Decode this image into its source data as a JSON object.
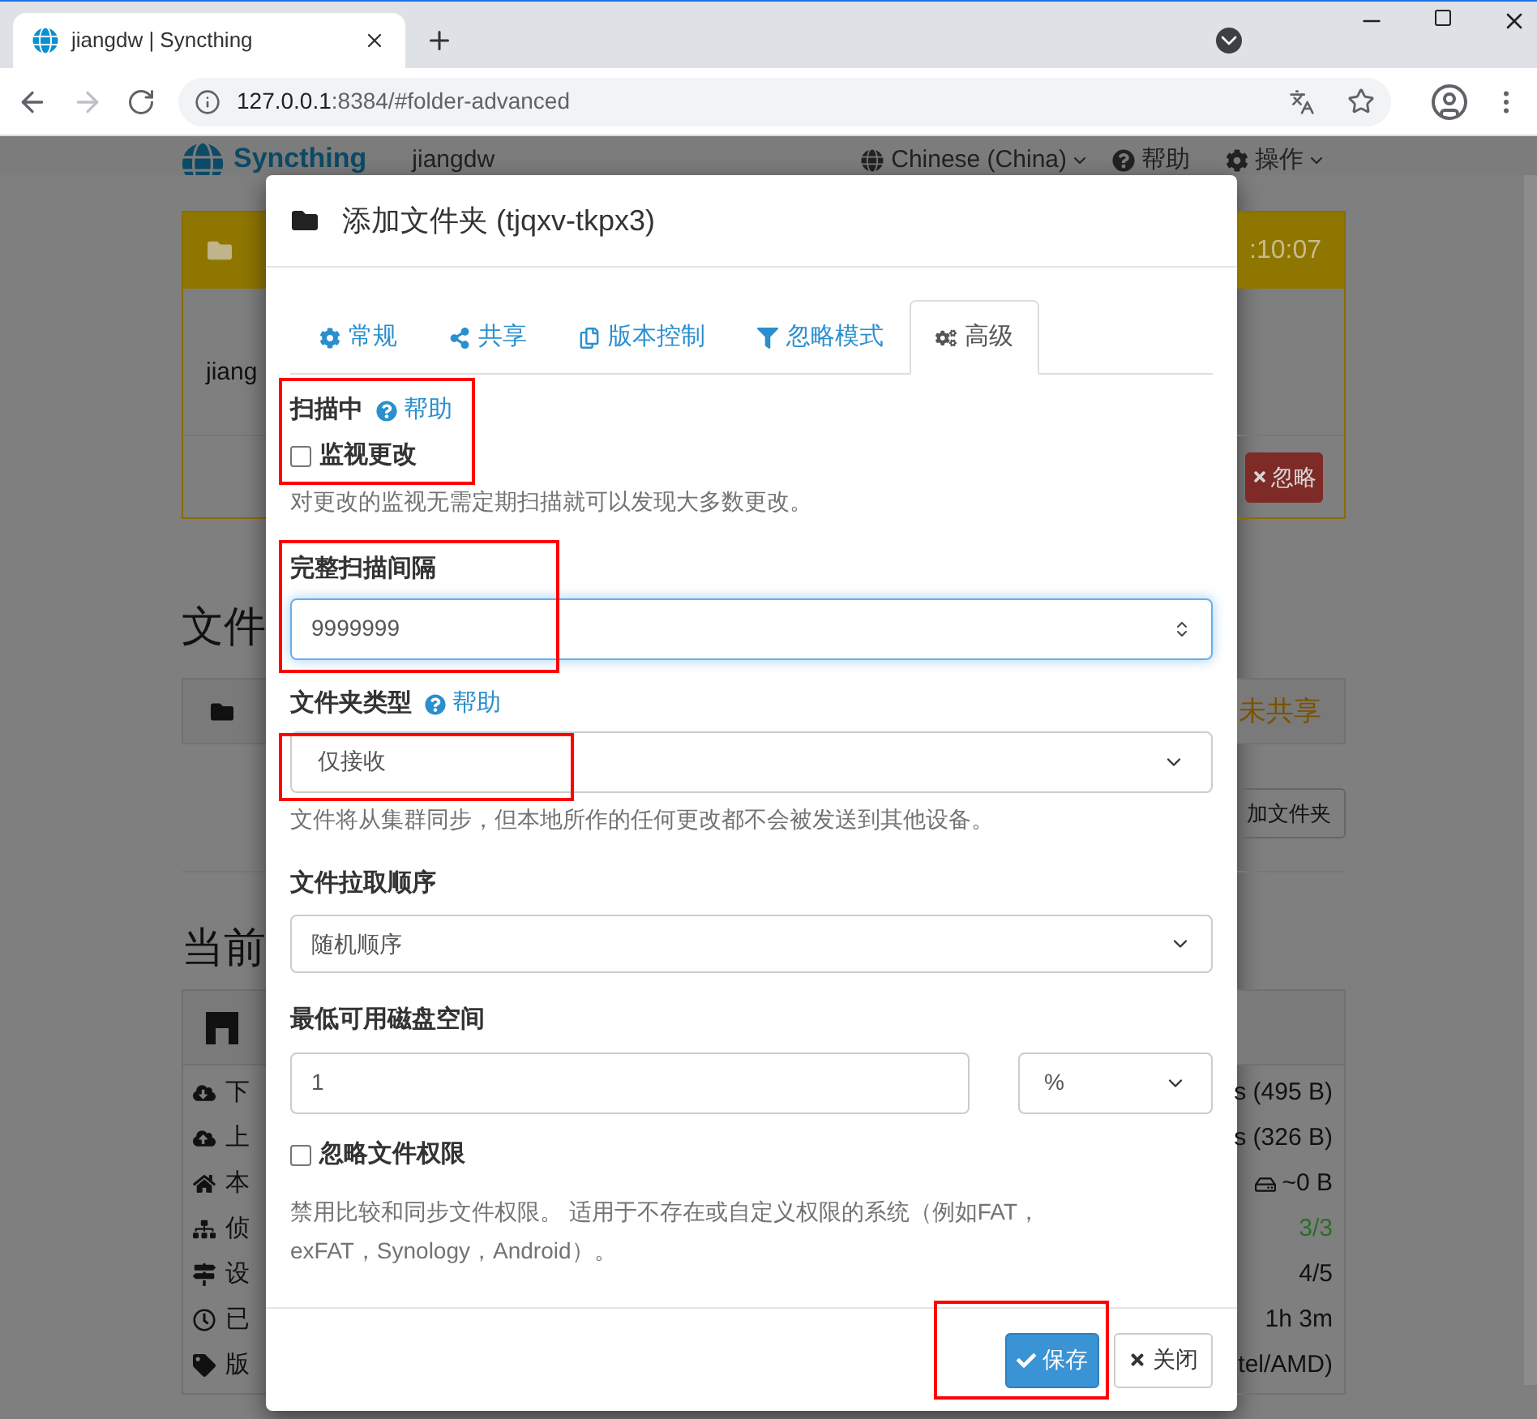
{
  "browser": {
    "tab_title": "jiangdw | Syncthing",
    "address_host": "127.0.0.1",
    "address_rest": ":8384/#folder-advanced"
  },
  "app_header": {
    "brand": "Syncthing",
    "device": "jiangdw",
    "language": "Chinese (China)",
    "help": "帮助",
    "actions": "操作"
  },
  "background_left": {
    "notice_body": "jiang",
    "section_1": "文件",
    "section_2": "当前",
    "stat_labels": [
      "下",
      "上",
      "本",
      "侦",
      "设",
      "已",
      "版"
    ]
  },
  "background_right": {
    "notice_time": ":10:07",
    "ignore_button": "忽略",
    "folder_status": "未共享",
    "add_folder_button": "加文件夹",
    "stat_values": [
      {
        "text": "s (495 B)",
        "color": "#111111"
      },
      {
        "text": "s (326 B)",
        "color": "#111111"
      },
      {
        "text": "~0 B",
        "color": "#111111"
      },
      {
        "text": "3/3",
        "color": "#2e6b2e"
      },
      {
        "text": "4/5",
        "color": "#111111"
      },
      {
        "text": "1h 3m",
        "color": "#111111"
      },
      {
        "text": "tel/AMD)",
        "color": "#111111"
      }
    ]
  },
  "dialog": {
    "title": "添加文件夹 (tjqxv-tkpx3)",
    "tabs": [
      {
        "label": "常规",
        "selected": false
      },
      {
        "label": "共享",
        "selected": false
      },
      {
        "label": "版本控制",
        "selected": false
      },
      {
        "label": "忽略模式",
        "selected": false
      },
      {
        "label": "高级",
        "selected": true
      }
    ],
    "scanning": {
      "label": "扫描中",
      "help": "帮助",
      "watch": {
        "label": "监视更改",
        "checked": false
      },
      "hint": "对更改的监视无需定期扫描就可以发现大多数更改。"
    },
    "full_scan": {
      "label": "完整扫描间隔",
      "value": "9999999"
    },
    "folder_type": {
      "label": "文件夹类型",
      "help": "帮助",
      "value": "仅接收",
      "hint": "文件将从集群同步，但本地所作的任何更改都不会被发送到其他设备。"
    },
    "pull_order": {
      "label": "文件拉取顺序",
      "value": "随机顺序"
    },
    "min_disk": {
      "label": "最低可用磁盘空间",
      "value": "1",
      "unit": "%"
    },
    "ignore_perms": {
      "label": "忽略文件权限",
      "checked": false,
      "hint": "禁用比较和同步文件权限。 适用于不存在或自定义权限的系统（例如FAT，exFAT，Synology，Android）。"
    },
    "buttons": {
      "save": "保存",
      "close": "关闭"
    }
  }
}
